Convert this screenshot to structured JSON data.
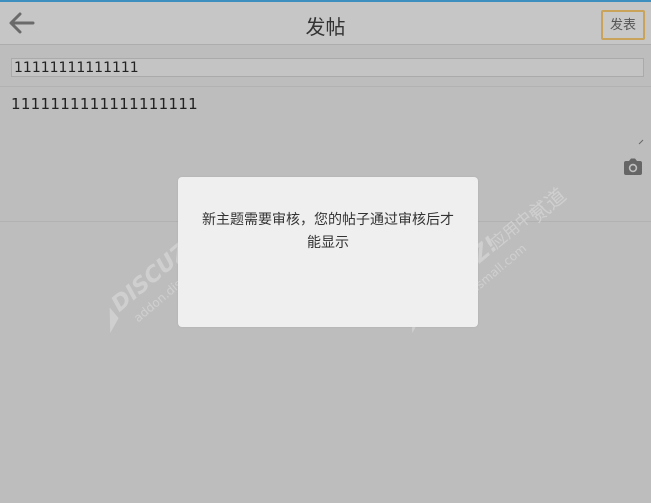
{
  "header": {
    "title": "发帖",
    "publish_label": "发表"
  },
  "form": {
    "subject_value": "11111111111111",
    "content_value": "1111111111111111111"
  },
  "modal": {
    "message": "新主题需要审核，您的帖子通过审核后才能显示"
  },
  "watermark": {
    "brand_text": "DISCUZ!",
    "suffix_text": "应用中心",
    "site_text": "addon.dismall.com",
    "sub_text": "贰道"
  },
  "colors": {
    "header_border_top": "#3d8fc0",
    "publish_border": "#c9a35a"
  },
  "icons": {
    "back": "back-arrow-icon",
    "camera": "camera-icon"
  }
}
